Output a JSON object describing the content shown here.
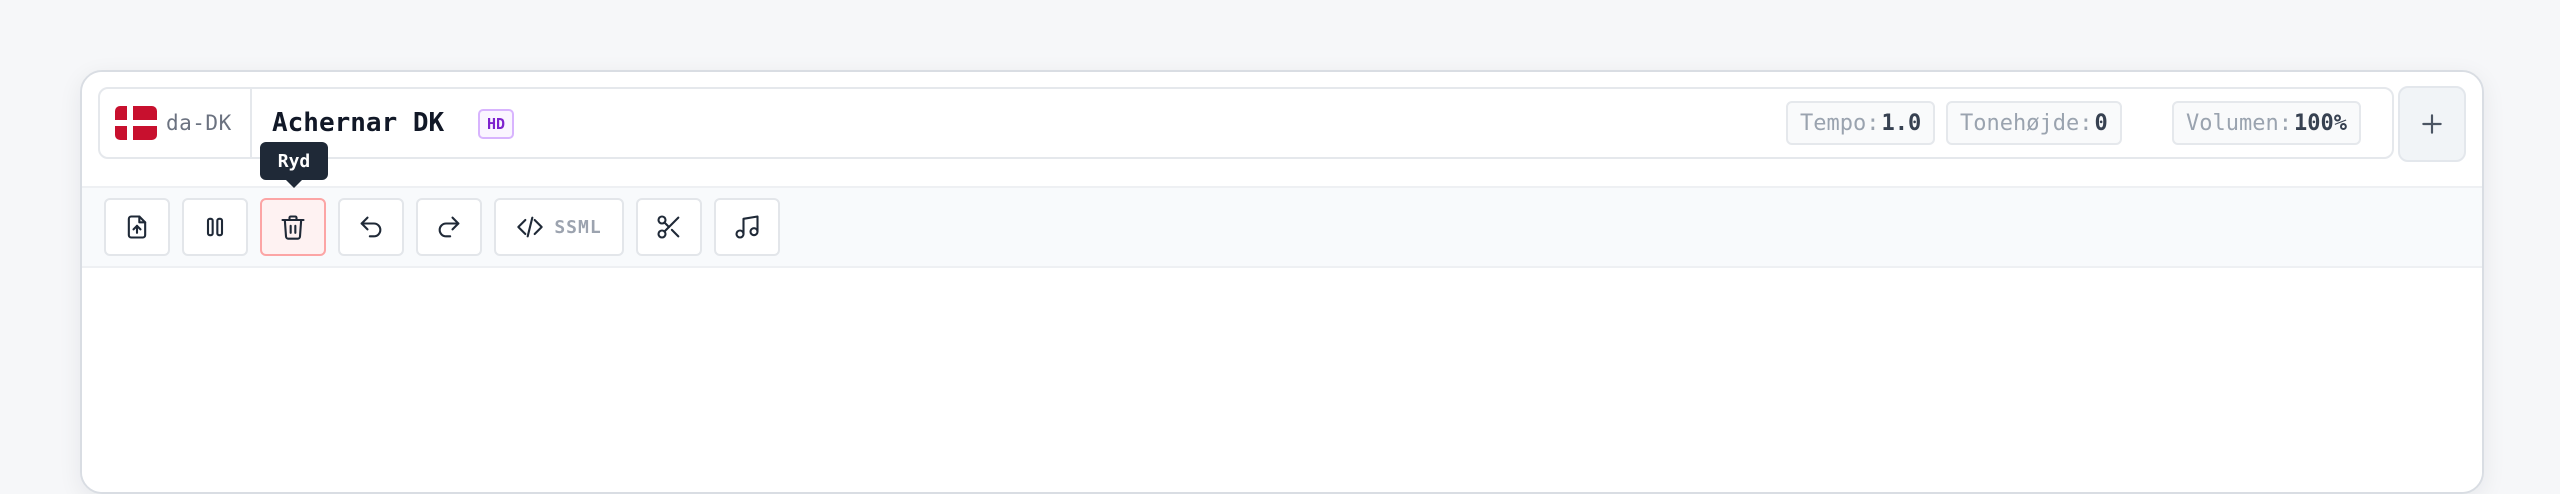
{
  "voice": {
    "lang_code": "da-DK",
    "name": "Achernar DK",
    "badge": "HD",
    "flag_icon": "denmark-flag-icon"
  },
  "params": {
    "tempo": {
      "label": "Tempo:",
      "value": "1.0"
    },
    "pitch": {
      "label": "Tonehøjde:",
      "value": "0"
    },
    "volume": {
      "label": "Volumen:",
      "value": "100%"
    }
  },
  "toolbar": {
    "tooltip": "Ryd",
    "ssml_label": "SSML",
    "buttons": [
      {
        "icon": "file-upload-icon"
      },
      {
        "icon": "pause-icon"
      },
      {
        "icon": "trash-icon",
        "active": true
      },
      {
        "icon": "undo-icon"
      },
      {
        "icon": "redo-icon"
      },
      {
        "icon": "code-icon"
      },
      {
        "icon": "scissors-icon"
      },
      {
        "icon": "music-note-icon"
      }
    ]
  },
  "colors": {
    "accent_danger_bg": "#fef2f2",
    "accent_danger_border": "#fca5a5",
    "flag_red": "#c8102e",
    "badge_purple": "#7e22ce"
  }
}
